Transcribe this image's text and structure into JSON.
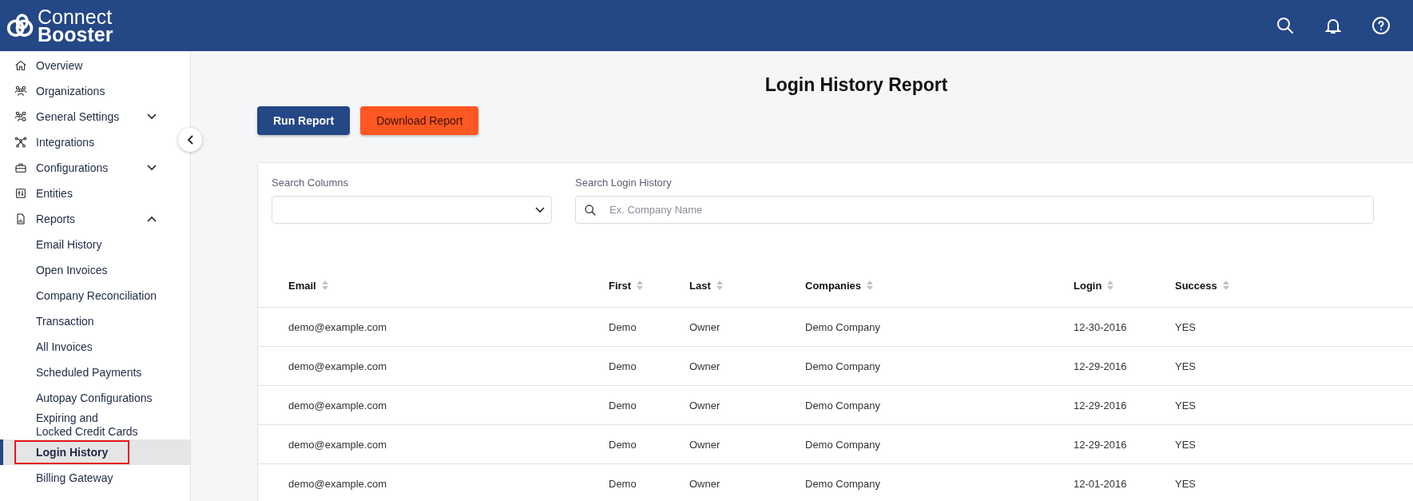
{
  "header": {
    "logo": {
      "line_1": "Connect",
      "line_2": "Booster"
    }
  },
  "sidebar": {
    "items": [
      {
        "label": "Overview",
        "selected": false
      },
      {
        "label": "Organizations",
        "selected": false
      },
      {
        "label": "General Settings",
        "selected": false,
        "expanded": false
      },
      {
        "label": "Integrations",
        "selected": false
      },
      {
        "label": "Configurations",
        "selected": false,
        "expanded": false
      },
      {
        "label": "Entities",
        "selected": false
      },
      {
        "label": "Reports",
        "selected": false,
        "expanded": true,
        "children": [
          {
            "label": "Email History",
            "selected": false
          },
          {
            "label": "Open Invoices",
            "selected": false
          },
          {
            "label": "Company Reconciliation",
            "selected": false
          },
          {
            "label": "Transaction",
            "selected": false
          },
          {
            "label": "All Invoices",
            "selected": false
          },
          {
            "label": "Scheduled Payments",
            "selected": false
          },
          {
            "label": "Autopay Configurations",
            "selected": false
          },
          {
            "label": "Expiring and\nLocked Credit Cards",
            "selected": false
          },
          {
            "label": "Login History",
            "selected": true
          },
          {
            "label": "Billing Gateway",
            "selected": false
          }
        ]
      }
    ]
  },
  "page": {
    "title": "Login History Report",
    "buttons": [
      {
        "label": "Run Report",
        "kind": "primary"
      },
      {
        "label": "Download Report",
        "kind": "accent"
      }
    ]
  },
  "filters": {
    "search_columns": {
      "label": "Search Columns"
    },
    "search": {
      "label": "Search Login History",
      "placeholder": "Ex. Company Name"
    }
  },
  "table": {
    "columns": [
      "Email",
      "First",
      "Last",
      "Companies",
      "Login",
      "Success"
    ],
    "rows": [
      [
        "demo@example.com",
        "Demo",
        "Owner",
        "Demo Company",
        "12-30-2016",
        "YES"
      ],
      [
        "demo@example.com",
        "Demo",
        "Owner",
        "Demo Company",
        "12-29-2016",
        "YES"
      ],
      [
        "demo@example.com",
        "Demo",
        "Owner",
        "Demo Company",
        "12-29-2016",
        "YES"
      ],
      [
        "demo@example.com",
        "Demo",
        "Owner",
        "Demo Company",
        "12-29-2016",
        "YES"
      ],
      [
        "demo@example.com",
        "Demo",
        "Owner",
        "Demo Company",
        "12-01-2016",
        "YES"
      ]
    ]
  }
}
